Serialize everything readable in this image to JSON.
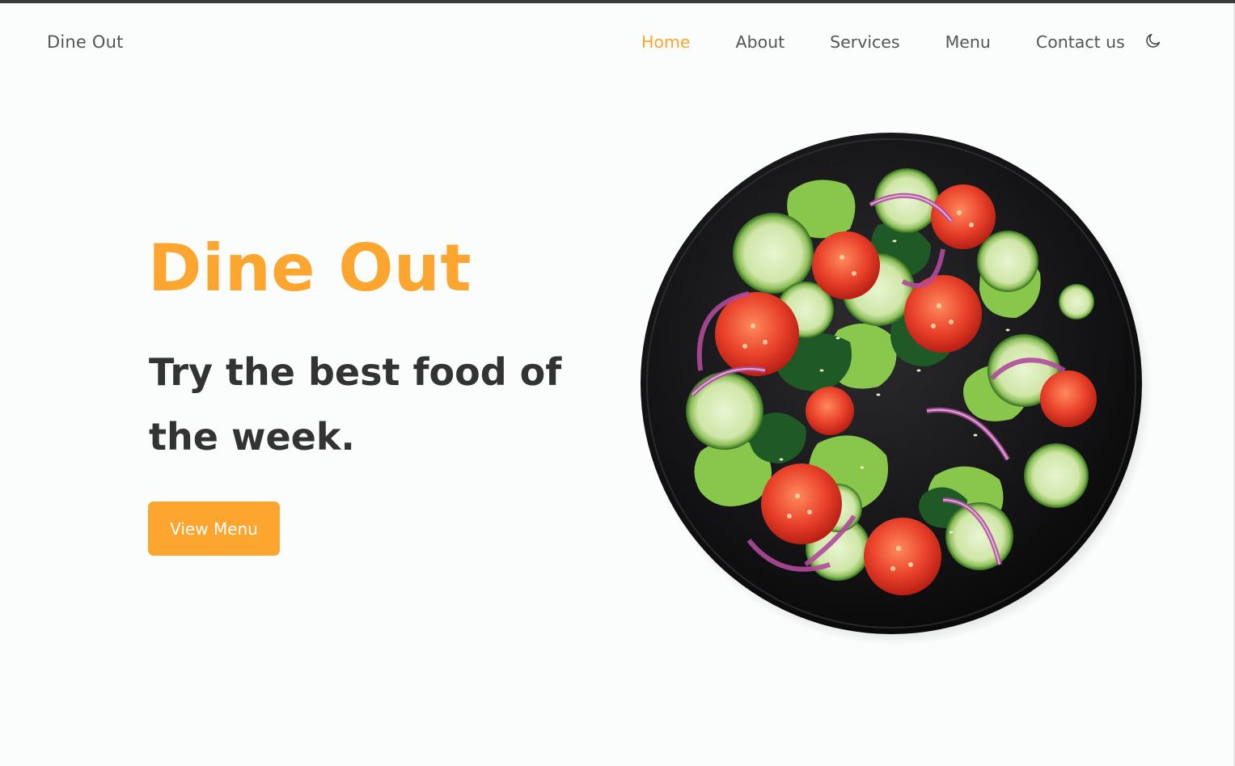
{
  "brand": "Dine Out",
  "nav": {
    "items": [
      {
        "label": "Home",
        "active": true
      },
      {
        "label": "About",
        "active": false
      },
      {
        "label": "Services",
        "active": false
      },
      {
        "label": "Menu",
        "active": false
      },
      {
        "label": "Contact us",
        "active": false
      }
    ],
    "theme_toggle_icon": "moon-icon"
  },
  "hero": {
    "title": "Dine Out",
    "subtitle": "Try the best food of the week.",
    "cta_label": "View Menu",
    "image_icon": "salad-bowl-image"
  },
  "colors": {
    "accent": "#fca52f",
    "text_dark": "#333333",
    "text_muted": "#555555",
    "background": "#fbfcfc"
  }
}
